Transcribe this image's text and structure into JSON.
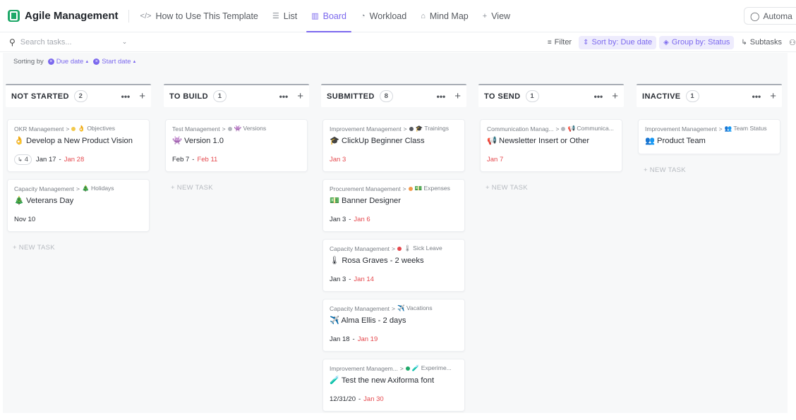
{
  "app": {
    "title": "Agile Management"
  },
  "views": [
    {
      "icon": "</>",
      "label": "How to Use This Template",
      "name": "how-to"
    },
    {
      "icon": "☰",
      "label": "List",
      "name": "list"
    },
    {
      "icon": "▥",
      "label": "Board",
      "name": "board"
    },
    {
      "icon": "◔",
      "label": "Workload",
      "name": "workload"
    },
    {
      "icon": "⌂",
      "label": "Mind Map",
      "name": "mind-map"
    },
    {
      "icon": "+",
      "label": "View",
      "name": "add-view"
    }
  ],
  "active_view": "Board",
  "automate": {
    "label": "Automa",
    "icon": "robot-icon"
  },
  "toolbar": {
    "search_placeholder": "Search tasks...",
    "filter": "Filter",
    "sort": "Sort by: Due date",
    "group": "Group by: Status",
    "subtasks": "Subtasks",
    "more": "²"
  },
  "sorting": {
    "label": "Sorting by",
    "chips": [
      "Due date",
      "Start date"
    ]
  },
  "columns": [
    {
      "name": "NOT STARTED",
      "count": "2",
      "cards": [
        {
          "list": "OKR Management",
          "dot": "#f2c94c",
          "tag": "👌 Objectives",
          "emoji": "👌",
          "title": "Develop a New Product Vision",
          "subtasks": "4",
          "start": "Jan 17",
          "due": "Jan 28"
        },
        {
          "list": "Capacity Management",
          "dot": "",
          "tag": "🎄 Holidays",
          "emoji": "🎄",
          "title": "Veterans Day",
          "subtasks": "",
          "start": "Nov 10",
          "due": ""
        }
      ],
      "new_task": "+ NEW TASK"
    },
    {
      "name": "TO BUILD",
      "count": "1",
      "cards": [
        {
          "list": "Test Management",
          "dot": "#b3b7bd",
          "tag": "👾 Versions",
          "emoji": "👾",
          "title": "Version 1.0",
          "subtasks": "",
          "start": "Feb 7",
          "due": "Feb 11"
        }
      ],
      "new_task": "+ NEW TASK"
    },
    {
      "name": "SUBMITTED",
      "count": "8",
      "cards": [
        {
          "list": "Improvement Management",
          "dot": "#55595f",
          "tag": "🎓 Trainings",
          "emoji": "🎓",
          "title": "ClickUp Beginner Class",
          "subtasks": "",
          "start": "",
          "due": "Jan 3"
        },
        {
          "list": "Procurement Management",
          "dot": "#f2994a",
          "tag": "💵 Expenses",
          "emoji": "💵",
          "title": "Banner Designer",
          "subtasks": "",
          "start": "Jan 3",
          "due": "Jan 6"
        },
        {
          "list": "Capacity Management",
          "dot": "#e5484d",
          "tag": "🌡 Sick Leave",
          "emoji": "🌡",
          "title": "Rosa Graves - 2 weeks",
          "subtasks": "",
          "start": "Jan 3",
          "due": "Jan 14"
        },
        {
          "list": "Capacity Management",
          "dot": "",
          "tag": "✈️ Vacations",
          "emoji": "✈️",
          "title": "Alma Ellis - 2 days",
          "subtasks": "",
          "start": "Jan 18",
          "due": "Jan 19"
        },
        {
          "list": "Improvement Managem...",
          "dot": "#1fa869",
          "tag": "🧪 Experime...",
          "emoji": "🧪",
          "title": "Test the new Axiforma font",
          "subtasks": "",
          "start": "12/31/20",
          "due": "Jan 30"
        }
      ],
      "new_task": ""
    },
    {
      "name": "TO SEND",
      "count": "1",
      "cards": [
        {
          "list": "Communication Manag...",
          "dot": "#b3b7bd",
          "tag": "📢 Communica...",
          "emoji": "📢",
          "title": "Newsletter Insert or Other",
          "subtasks": "",
          "start": "",
          "due": "Jan 7"
        }
      ],
      "new_task": "+ NEW TASK"
    },
    {
      "name": "INACTIVE",
      "count": "1",
      "cards": [
        {
          "list": "Improvement Management",
          "dot": "",
          "tag": "👥 Team Status",
          "emoji": "👥",
          "title": "Product Team",
          "subtasks": "",
          "start": "",
          "due": ""
        }
      ],
      "new_task": "+ NEW TASK"
    }
  ]
}
